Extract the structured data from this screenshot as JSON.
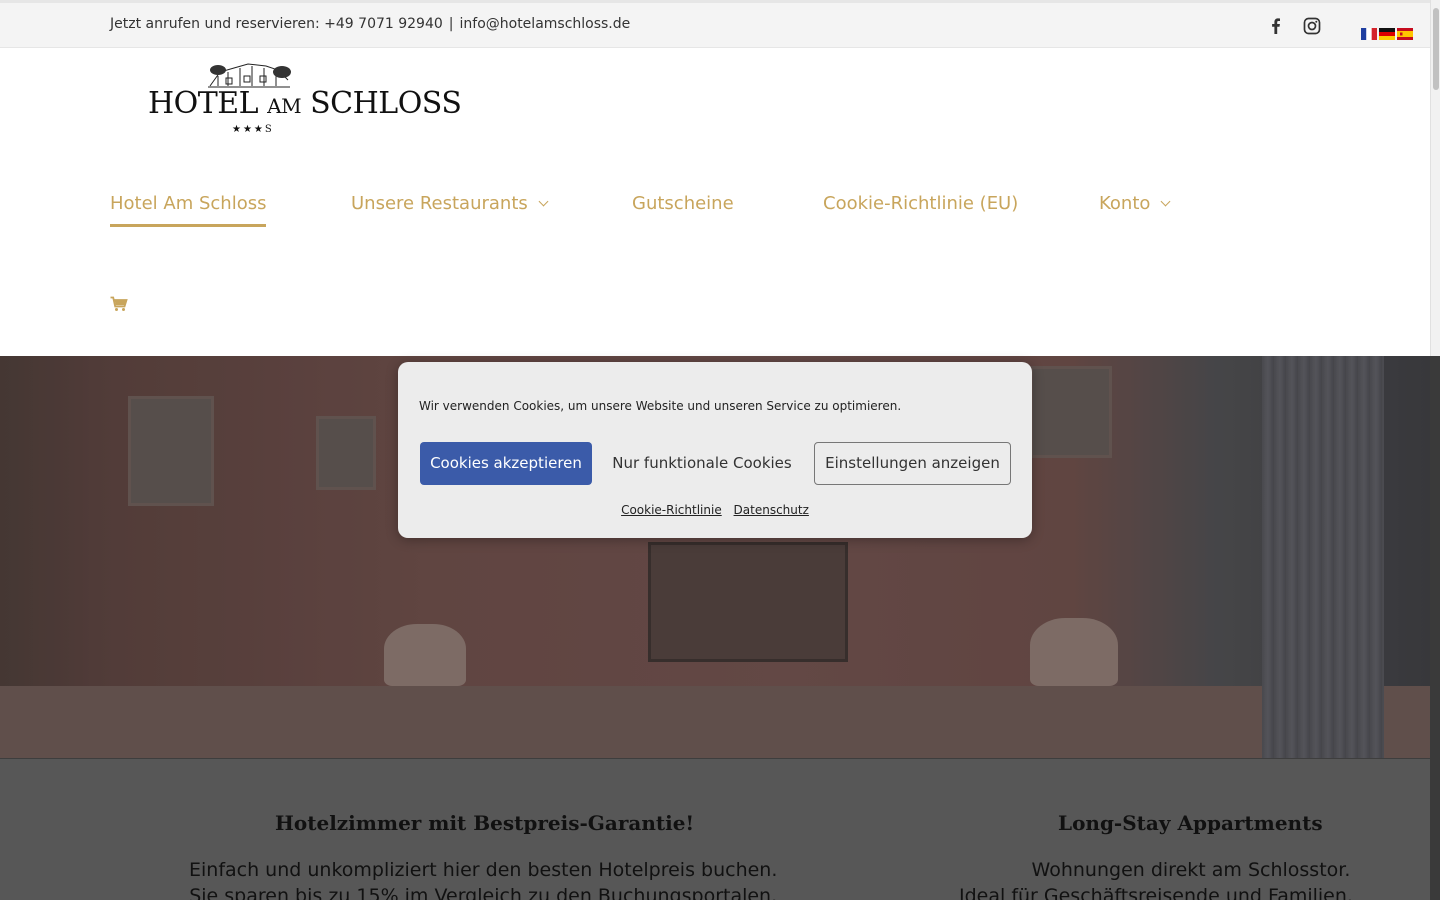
{
  "topbar": {
    "phone_text": "Jetzt anrufen und reservieren: +49 7071 92940",
    "separator": "|",
    "email": "info@hotelamschloss.de",
    "social": [
      "facebook-icon",
      "instagram-icon"
    ],
    "languages": [
      "fr",
      "de",
      "es"
    ]
  },
  "logo": {
    "text_main": "HOTEL",
    "text_small": "AM",
    "text_end": "SCHLOSS",
    "stars": "★★★S"
  },
  "nav": {
    "items": [
      {
        "label": "Hotel Am Schloss",
        "active": true,
        "has_dropdown": false
      },
      {
        "label": "Unsere Restaurants",
        "active": false,
        "has_dropdown": true
      },
      {
        "label": "Gutscheine",
        "active": false,
        "has_dropdown": false
      },
      {
        "label": "Cookie-Richtlinie (EU)",
        "active": false,
        "has_dropdown": false
      },
      {
        "label": "Konto",
        "active": false,
        "has_dropdown": true
      }
    ],
    "cart_icon": "cart-icon",
    "accent_color": "#c8a55c"
  },
  "cookie_banner": {
    "message": "Wir verwenden Cookies, um unsere Website und unseren Service zu optimieren.",
    "accept_label": "Cookies akzeptieren",
    "functional_label": "Nur funktionale Cookies",
    "settings_label": "Einstellungen anzeigen",
    "policy_link": "Cookie-Richtlinie",
    "privacy_link": "Datenschutz",
    "accept_color": "#3b5ba9"
  },
  "sections": [
    {
      "heading": "Hotelzimmer mit Bestpreis-Garantie!",
      "line1": "Einfach und unkompliziert hier den besten Hotelpreis buchen.",
      "line2": "Sie sparen bis zu 15% im Vergleich zu den Buchungsportalen."
    },
    {
      "heading": "Long-Stay Appartments",
      "line1": "Wohnungen direkt am Schlosstor.",
      "line2": "Ideal für Geschäftsreisende und Familien."
    }
  ]
}
